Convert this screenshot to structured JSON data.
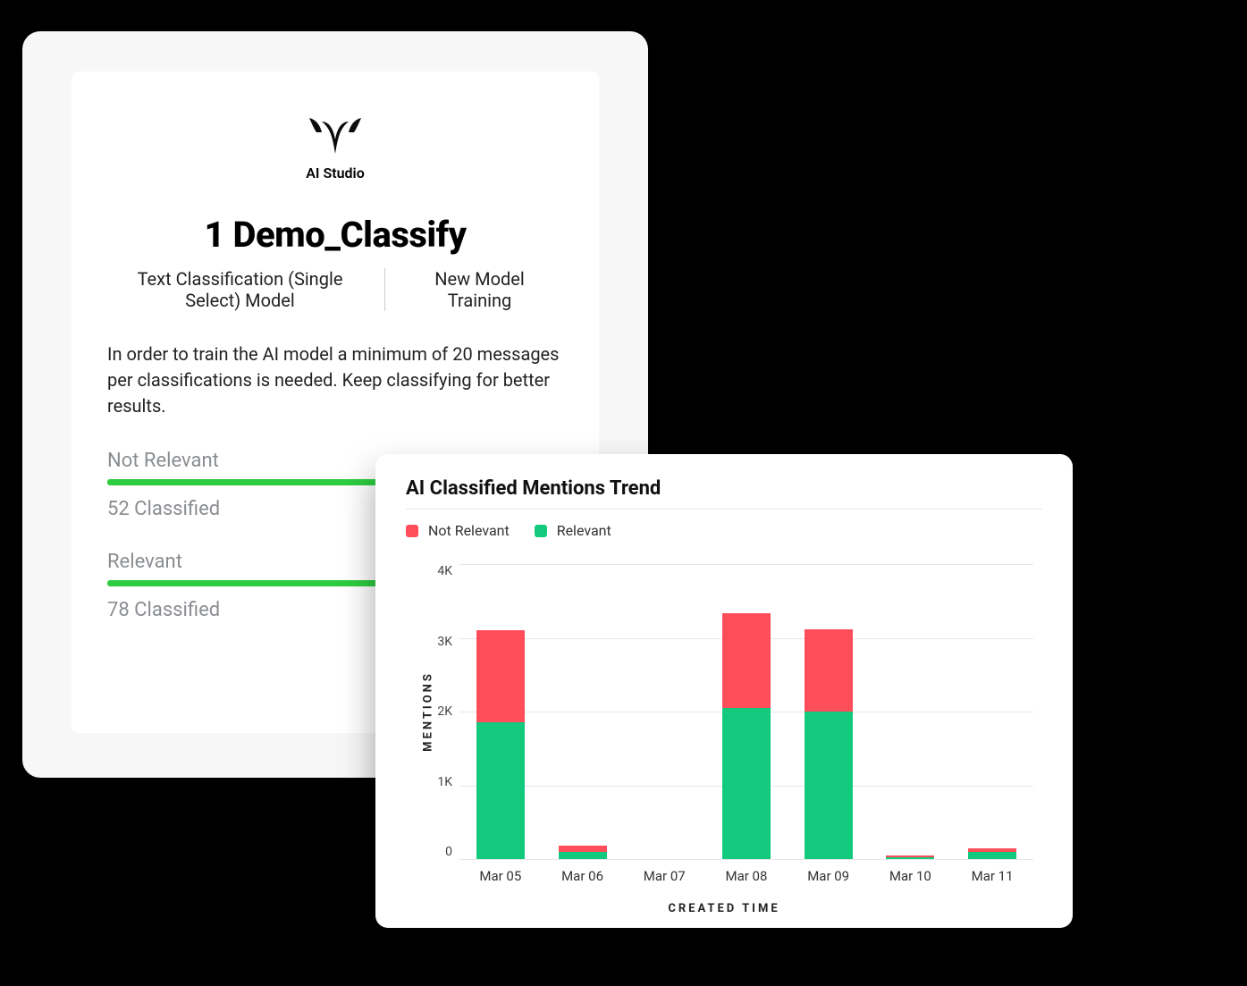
{
  "card": {
    "logo_label": "AI Studio",
    "title": "1 Demo_Classify",
    "meta_left": "Text Classification (Single Select) Model",
    "meta_right": "New Model Training",
    "description": "In order to train the AI model a minimum of 20 messages per classifications is needed. Keep classifying for better results.",
    "classes": [
      {
        "label": "Not Relevant",
        "classified_text": "52 Classified",
        "classified": 52
      },
      {
        "label": "Relevant",
        "classified_text": "78 Classified",
        "classified": 78
      }
    ]
  },
  "chart": {
    "title": "AI Classified Mentions Trend",
    "legend_not_relevant": "Not Relevant",
    "legend_relevant": "Relevant",
    "yaxis_title": "MENTIONS",
    "xaxis_title": "CREATED TIME",
    "y_tick_labels": [
      "4K",
      "3K",
      "2K",
      "1K",
      "0"
    ]
  },
  "colors": {
    "green": "#12c97d",
    "red": "#ff4d5a"
  },
  "chart_data": {
    "type": "bar",
    "stacked": true,
    "title": "AI Classified Mentions Trend",
    "xlabel": "CREATED TIME",
    "ylabel": "MENTIONS",
    "ylim": [
      0,
      4000
    ],
    "categories": [
      "Mar 05",
      "Mar 06",
      "Mar 07",
      "Mar 08",
      "Mar 09",
      "Mar 10",
      "Mar 11"
    ],
    "series": [
      {
        "name": "Relevant",
        "color": "#12c97d",
        "values": [
          1850,
          100,
          0,
          2050,
          2000,
          30,
          100
        ]
      },
      {
        "name": "Not Relevant",
        "color": "#ff4d5a",
        "values": [
          1250,
          80,
          0,
          1280,
          1120,
          20,
          40
        ]
      }
    ]
  }
}
